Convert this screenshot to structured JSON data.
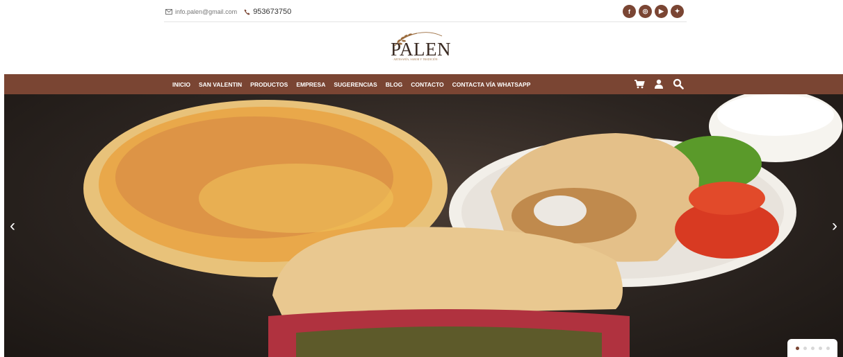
{
  "topbar": {
    "email": "info.palen@gmail.com",
    "phone": "953673750",
    "socials": [
      {
        "name": "facebook",
        "glyph": "f"
      },
      {
        "name": "instagram",
        "glyph": "◎"
      },
      {
        "name": "youtube",
        "glyph": "▶"
      },
      {
        "name": "twitter",
        "glyph": "✦"
      }
    ]
  },
  "logo": {
    "name": "PALEN",
    "tagline": "· ARTESANÍA, SABOR Y TRADICIÓN ·"
  },
  "nav": {
    "links": [
      "INICIO",
      "SAN VALENTIN",
      "PRODUCTOS",
      "EMPRESA",
      "SUGERENCIAS",
      "BLOG",
      "CONTACTO",
      "CONTACTA VÍA WHATSAPP"
    ],
    "icons": [
      "cart-icon",
      "user-icon",
      "search-icon"
    ]
  },
  "hero": {
    "prev": "‹",
    "next": "›",
    "slides": 5,
    "active_slide": 1
  },
  "colors": {
    "brand": "#7a4533",
    "logo_text": "#3a2a22",
    "gold": "#9a6b3d"
  }
}
